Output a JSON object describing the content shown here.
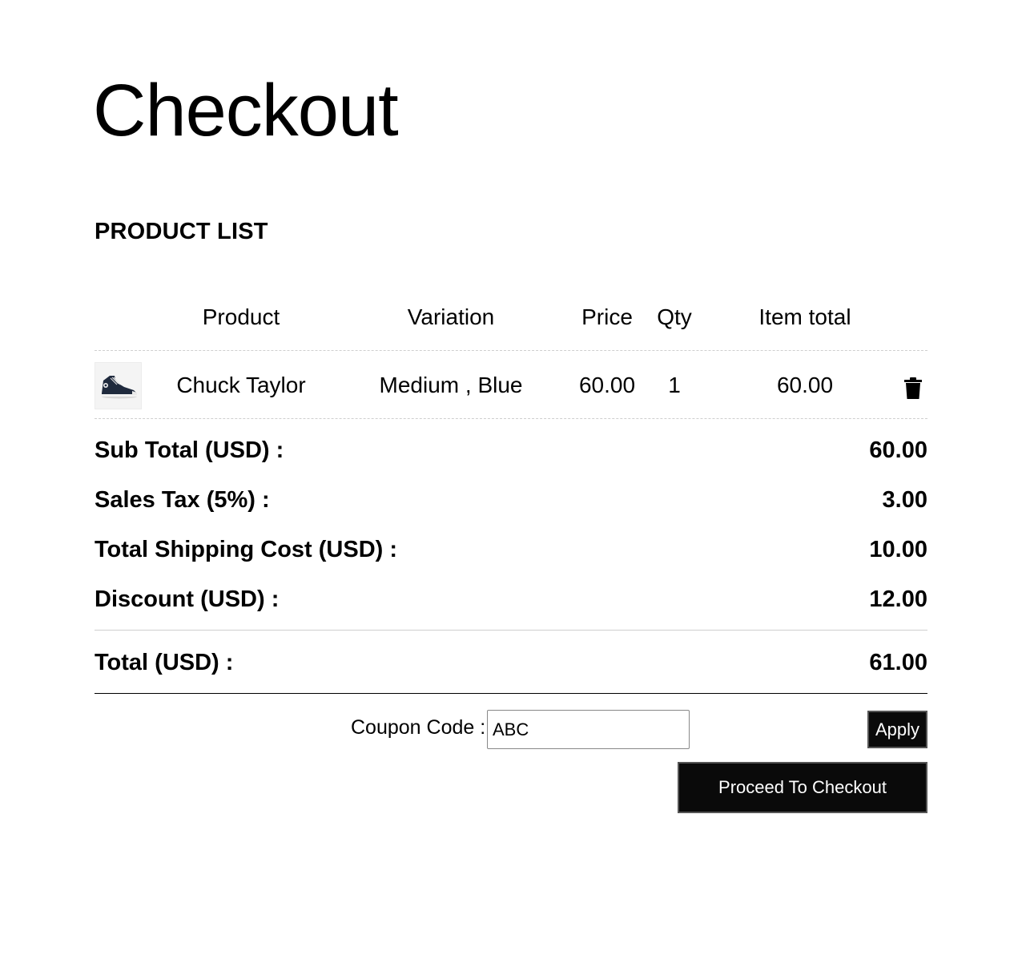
{
  "page": {
    "title": "Checkout",
    "section_title": "PRODUCT LIST"
  },
  "table": {
    "headers": {
      "product": "Product",
      "variation": "Variation",
      "price": "Price",
      "qty": "Qty",
      "item_total": "Item total"
    },
    "rows": [
      {
        "image_icon": "sneaker-thumbnail",
        "product": "Chuck Taylor",
        "variation": "Medium , Blue",
        "price": "60.00",
        "qty": "1",
        "item_total": "60.00",
        "delete_icon": "trash-icon"
      }
    ]
  },
  "summary": {
    "sub_total_label": "Sub Total (USD) :",
    "sub_total_value": "60.00",
    "sales_tax_label": "Sales Tax (5%) :",
    "sales_tax_value": "3.00",
    "shipping_label": "Total Shipping Cost (USD) :",
    "shipping_value": "10.00",
    "discount_label": "Discount (USD) :",
    "discount_value": "12.00",
    "total_label": "Total (USD) :",
    "total_value": "61.00"
  },
  "coupon": {
    "label": "Coupon Code :",
    "value": "ABC",
    "apply_label": "Apply"
  },
  "actions": {
    "checkout_label": "Proceed To Checkout"
  }
}
